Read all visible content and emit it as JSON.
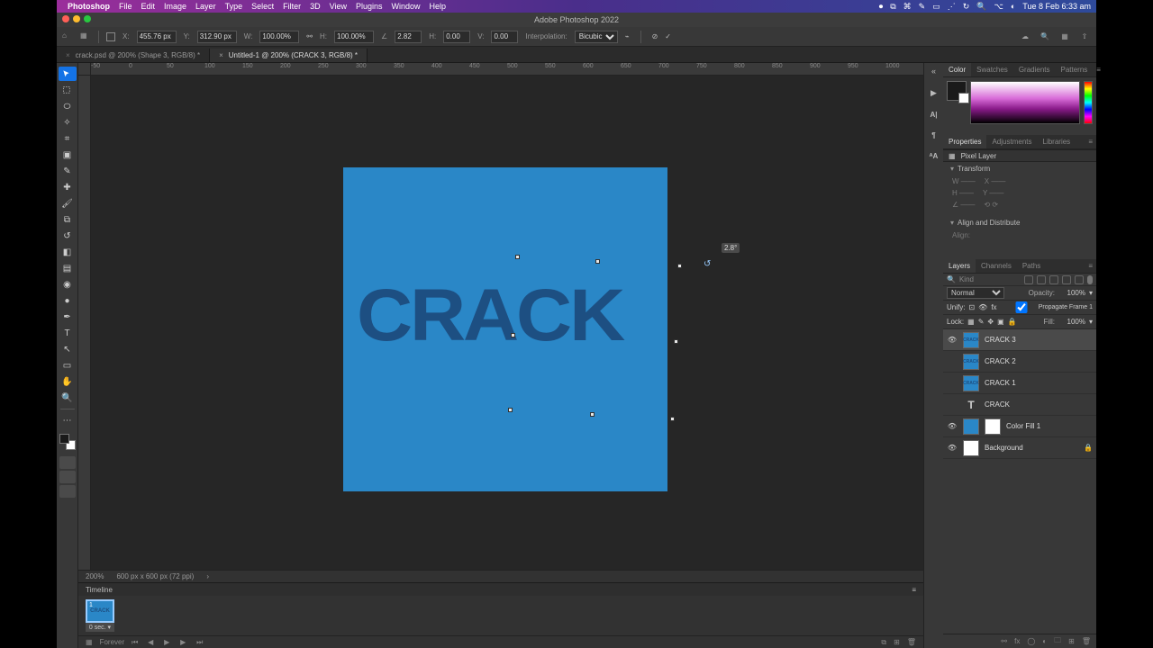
{
  "mac_menu": {
    "app": "Photoshop",
    "items": [
      "File",
      "Edit",
      "Image",
      "Layer",
      "Type",
      "Select",
      "Filter",
      "3D",
      "View",
      "Plugins",
      "Window",
      "Help"
    ],
    "clock": "Tue 8 Feb 6:33 am"
  },
  "titlebar": "Adobe Photoshop 2022",
  "options": {
    "x_label": "X:",
    "x_value": "455.76 px",
    "y_label": "Y:",
    "y_value": "312.90 px",
    "w_label": "W:",
    "w_value": "100.00%",
    "h_label": "H:",
    "h_value": "100.00%",
    "rot_label": "∠",
    "rot_value": "2.82",
    "hskew_label": "H:",
    "hskew_value": "0.00",
    "vskew_label": "V:",
    "vskew_value": "0.00",
    "interp_label": "Interpolation:",
    "interp_value": "Bicubic"
  },
  "tabs": [
    {
      "label": "crack.psd @ 200% (Shape 3, RGB/8) *",
      "active": false
    },
    {
      "label": "Untitled-1 @ 200% (CRACK 3, RGB/8) *",
      "active": true
    }
  ],
  "ruler_ticks": [
    "-50",
    "0",
    "50",
    "100",
    "150",
    "200",
    "250",
    "300",
    "350",
    "400",
    "450",
    "500",
    "550",
    "600",
    "650",
    "700",
    "750",
    "800",
    "850",
    "900",
    "950",
    "1000"
  ],
  "canvas": {
    "text": "CRACK",
    "rotation_tooltip": "2.8°"
  },
  "status": {
    "zoom": "200%",
    "docinfo": "600 px x 600 px (72 ppi)"
  },
  "color_tabs": [
    "Color",
    "Swatches",
    "Gradients",
    "Patterns"
  ],
  "prop_tabs": [
    "Properties",
    "Adjustments",
    "Libraries"
  ],
  "properties": {
    "kind": "Pixel Layer",
    "transform_label": "Transform",
    "align_label": "Align and Distribute",
    "align_sub": "Align:"
  },
  "layer_tabs": [
    "Layers",
    "Channels",
    "Paths"
  ],
  "layers_panel": {
    "filter_placeholder": "Kind",
    "blend": "Normal",
    "opacity_label": "Opacity:",
    "opacity_value": "100%",
    "unify_label": "Unify:",
    "propagate": "Propagate Frame 1",
    "lock_label": "Lock:",
    "fill_label": "Fill:",
    "fill_value": "100%"
  },
  "layers": [
    {
      "visible": true,
      "thumb": "crack",
      "name": "CRACK 3",
      "selected": true
    },
    {
      "visible": false,
      "thumb": "crack",
      "name": "CRACK 2"
    },
    {
      "visible": false,
      "thumb": "crack",
      "name": "CRACK 1"
    },
    {
      "visible": false,
      "thumb": "T",
      "name": "CRACK",
      "type": "text"
    },
    {
      "visible": true,
      "thumb": "fill",
      "name": "Color Fill 1",
      "mask": true
    },
    {
      "visible": true,
      "thumb": "white",
      "name": "Background",
      "locked": true
    }
  ],
  "timeline": {
    "tab": "Timeline",
    "frame_label": "CRACK",
    "frame_time": "0 sec. ▾",
    "loop": "Forever"
  }
}
